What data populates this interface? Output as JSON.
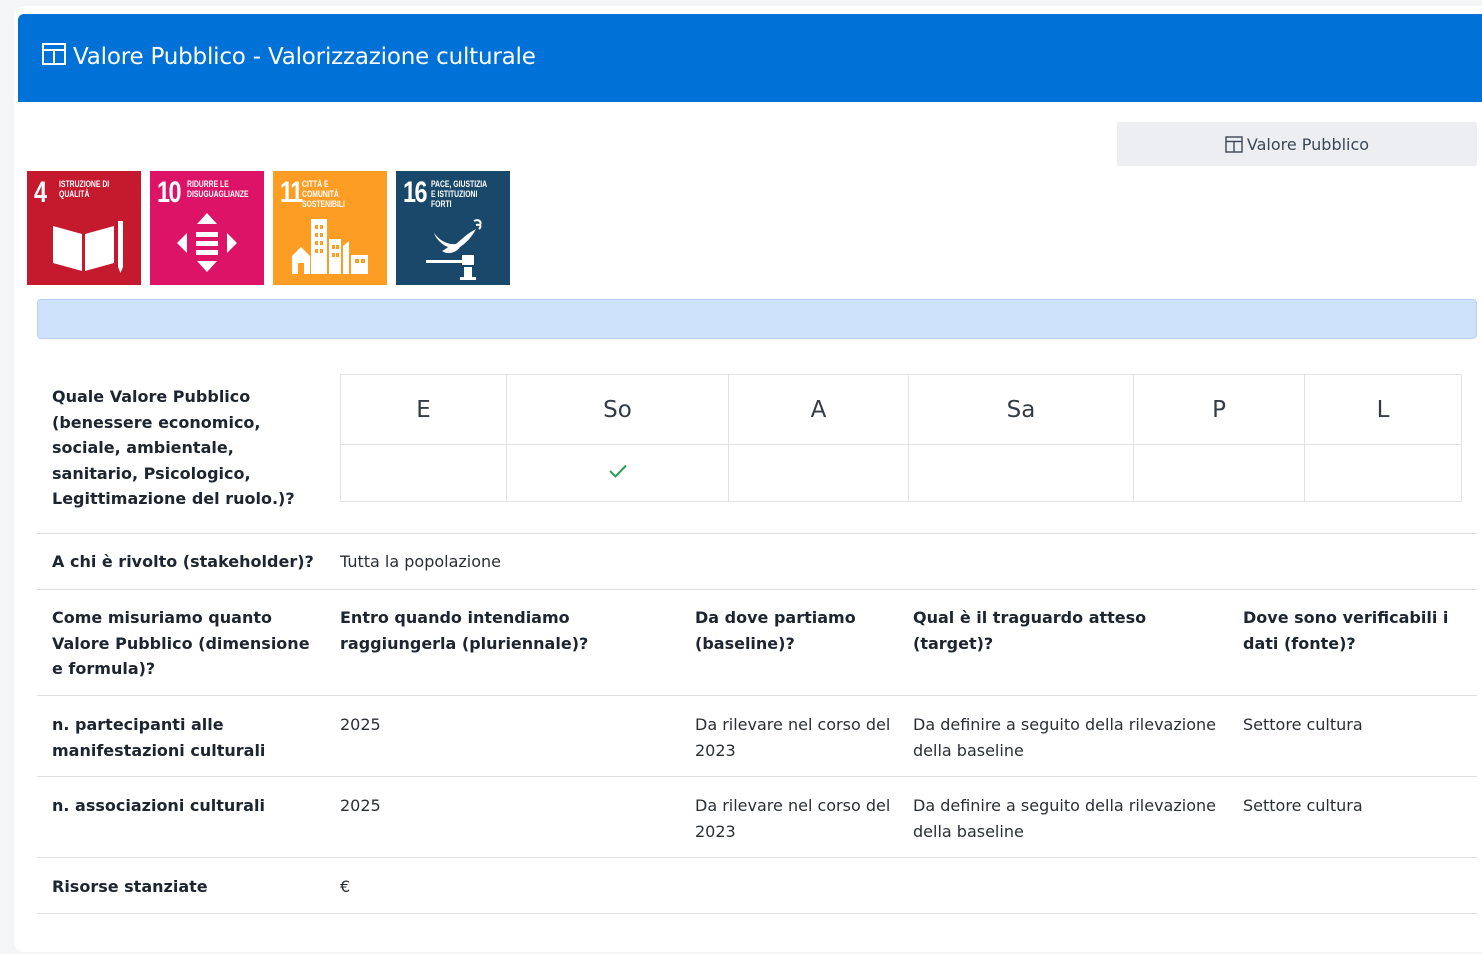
{
  "header": {
    "title": "Valore Pubblico - Valorizzazione culturale",
    "icon": "table-icon"
  },
  "vp_button": {
    "label": "Valore Pubblico",
    "icon": "table-icon"
  },
  "sdgs": [
    {
      "number": "4",
      "title": "ISTRUZIONE DI QUALITÀ",
      "color": "#c5192d",
      "icon": "book-pencil-icon"
    },
    {
      "number": "10",
      "title": "RIDURRE LE DISUGUAGLIANZE",
      "color": "#dd1367",
      "icon": "equality-arrows-icon"
    },
    {
      "number": "11",
      "title": "CITTÀ E COMUNITÀ SOSTENIBILI",
      "color": "#fd9d24",
      "icon": "city-buildings-icon"
    },
    {
      "number": "16",
      "title": "PACE, GIUSTIZIA E ISTITUZIONI FORTI",
      "color": "#19486a",
      "icon": "dove-gavel-icon"
    }
  ],
  "value_question": "Quale Valore Pubblico (benessere economico, sociale, ambientale, sanitario, Psicologico, Legittimazione del ruolo.)?",
  "dimensions": {
    "headers": [
      "E",
      "So",
      "A",
      "Sa",
      "P",
      "L"
    ],
    "checked": [
      false,
      true,
      false,
      false,
      false,
      false
    ],
    "check_color": "#2a9d55"
  },
  "stakeholder": {
    "label": "A chi è rivolto (stakeholder)?",
    "value": "Tutta la popolazione"
  },
  "measure_headers": [
    "Come misuriamo quanto Valore Pubblico (dimensione e formula)?",
    "Entro quando intendiamo raggiungerla (pluriennale)?",
    "Da dove partiamo (baseline)?",
    "Qual è il traguardo atteso (target)?",
    "Dove sono verificabili i dati (fonte)?"
  ],
  "indicators": [
    {
      "name": "n. partecipanti alle manifestazioni culturali",
      "deadline": "2025",
      "baseline": "Da rilevare nel corso del 2023",
      "target": "Da definire a seguito della rilevazione della baseline",
      "source": "Settore cultura"
    },
    {
      "name": "n. associazioni culturali",
      "deadline": "2025",
      "baseline": "Da rilevare nel corso del 2023",
      "target": "Da definire a seguito della rilevazione della baseline",
      "source": "Settore cultura"
    }
  ],
  "resources": {
    "label": "Risorse stanziate",
    "value": "€"
  }
}
